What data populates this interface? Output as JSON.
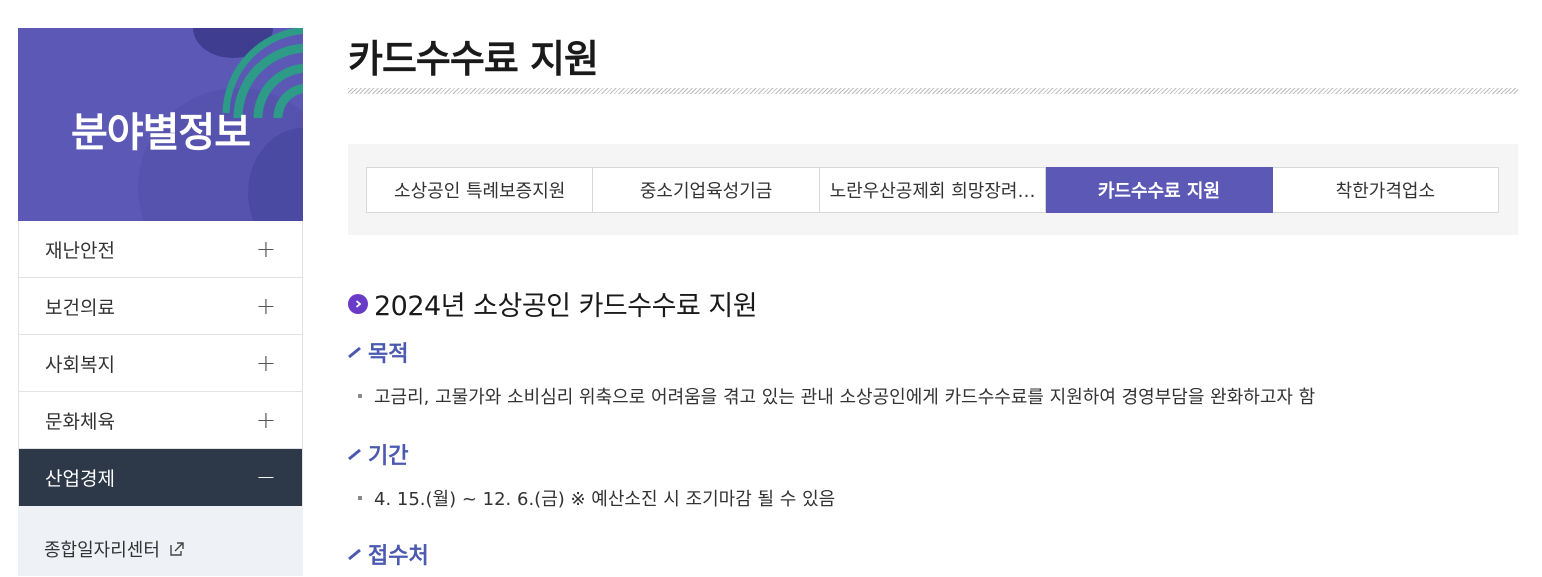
{
  "sidebar": {
    "banner_title": "분야별정보",
    "items": [
      {
        "label": "재난안전",
        "sign": "+"
      },
      {
        "label": "보건의료",
        "sign": "+"
      },
      {
        "label": "사회복지",
        "sign": "+"
      },
      {
        "label": "문화체육",
        "sign": "+"
      },
      {
        "label": "산업경제",
        "sign": "−"
      }
    ],
    "sub_items": [
      {
        "label": "종합일자리센터"
      }
    ]
  },
  "main": {
    "page_title": "카드수수료 지원",
    "tabs": [
      {
        "label": "소상공인 특례보증지원"
      },
      {
        "label": "중소기업육성기금"
      },
      {
        "label": "노란우산공제회 희망장려…"
      },
      {
        "label": "카드수수료 지원"
      },
      {
        "label": "착한가격업소"
      }
    ],
    "active_tab": "카드수수료 지원",
    "section_title": "2024년 소상공인 카드수수료 지원",
    "subsections": [
      {
        "heading": "목적",
        "text": "고금리, 고물가와 소비심리 위축으로 어려움을 겪고 있는 관내 소상공인에게 카드수수료를 지원하여 경영부담을 완화하고자 함"
      },
      {
        "heading": "기간",
        "text": "4. 15.(월) ~ 12. 6.(금) ※ 예산소진 시 조기마감 될 수 있음"
      },
      {
        "heading": "접수처",
        "text": ""
      }
    ]
  },
  "colors": {
    "brand_purple": "#5b59b5",
    "active_menu_bg": "#2d3848",
    "heading_blue": "#4b5ab0"
  }
}
